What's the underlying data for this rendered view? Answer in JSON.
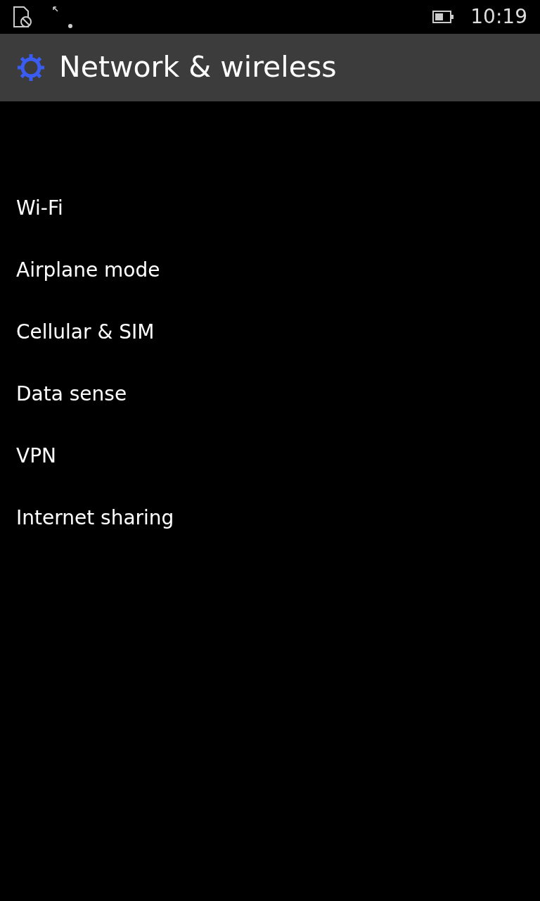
{
  "status_bar": {
    "time": "10:19"
  },
  "header": {
    "title": "Network & wireless"
  },
  "items": [
    {
      "label": "Wi-Fi"
    },
    {
      "label": "Airplane mode"
    },
    {
      "label": "Cellular & SIM"
    },
    {
      "label": "Data sense"
    },
    {
      "label": "VPN"
    },
    {
      "label": "Internet sharing"
    }
  ]
}
